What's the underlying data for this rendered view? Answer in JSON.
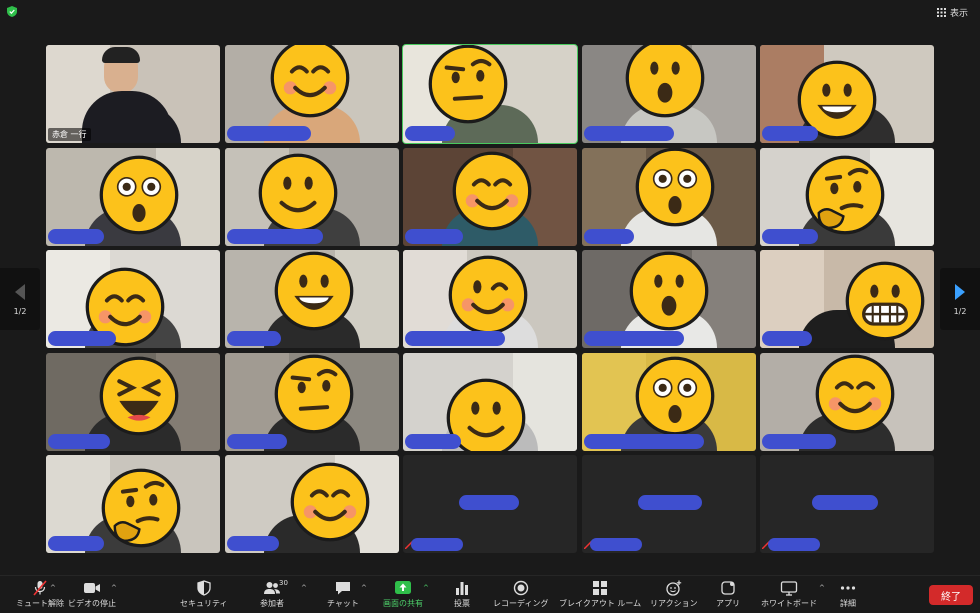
{
  "topbar": {
    "view_label": "表示"
  },
  "tiles": [
    {
      "bg": "#c9c2b8",
      "wall": "#e6e1d8",
      "person": "#1c1c22",
      "name": "赤倉 一行",
      "emoji": "none"
    },
    {
      "bg": "#b3aea6",
      "wall": "#d6d0c6",
      "person": "#d9a77a",
      "emoji": "smile-blush",
      "redact_w": 84
    },
    {
      "bg": "#d6d2c8",
      "wall": "#efece4",
      "person": "#5d6a58",
      "emoji": "raised-eyebrow",
      "redact_w": 50,
      "active": true
    },
    {
      "bg": "#8a8784",
      "wall": "#b8b4ae",
      "person": "#c7c7c2",
      "emoji": "surprised",
      "redact_w": 90
    },
    {
      "bg": "#cfc9bf",
      "wall": "#9b5c3c",
      "person": "#2f2e2e",
      "emoji": "grin",
      "redact_w": 56
    },
    {
      "bg": "#bdb8ae",
      "wall": "#e3ded4",
      "person": "#3a3a40",
      "emoji": "astonished",
      "redact_w": 56
    },
    {
      "bg": "#a9a59e",
      "wall": "#d2cdc3",
      "person": "#3f3f3f",
      "emoji": "slight-smile",
      "redact_w": 96
    },
    {
      "bg": "#5c4436",
      "wall": "#7a5b49",
      "person": "#2e5b67",
      "emoji": "smile-blush",
      "redact_w": 58
    },
    {
      "bg": "#6b5a48",
      "wall": "#8d7a63",
      "person": "#e6e6e3",
      "emoji": "astonished",
      "redact_w": 50
    },
    {
      "bg": "#d5d2cc",
      "wall": "#eeece7",
      "person": "#3a3a3a",
      "emoji": "thinking",
      "redact_w": 56
    },
    {
      "bg": "#dcd9d3",
      "wall": "#f1efea",
      "person": "#444",
      "emoji": "smile-blush",
      "redact_w": 68
    },
    {
      "bg": "#b8b4ac",
      "wall": "#dcd8cf",
      "person": "#2a2a2a",
      "emoji": "grin",
      "redact_w": 54
    },
    {
      "bg": "#cbc7bf",
      "wall": "#e9e6e0",
      "person": "#ddd",
      "emoji": "wink",
      "redact_w": 100
    },
    {
      "bg": "#6e6a66",
      "wall": "#8e8a84",
      "person": "#e8e8e6",
      "emoji": "surprised",
      "redact_w": 100
    },
    {
      "bg": "#c8b9a8",
      "wall": "#e4d8ca",
      "person": "#1e1e1e",
      "emoji": "big-grin",
      "redact_w": 50
    },
    {
      "bg": "#6f6a62",
      "wall": "#8b857b",
      "person": "#2b2b2b",
      "emoji": "laugh",
      "redact_w": 62
    },
    {
      "bg": "#8c8880",
      "wall": "#a9a49a",
      "person": "#2b2b2b",
      "emoji": "raised-eyebrow",
      "redact_w": 60
    },
    {
      "bg": "#d4d2cd",
      "wall": "#ecebe6",
      "person": "#bbb",
      "emoji": "slight-smile",
      "redact_w": 56
    },
    {
      "bg": "#d8b946",
      "wall": "#e7c957",
      "person": "#3a3a3a",
      "emoji": "astonished",
      "redact_w": 120
    },
    {
      "bg": "#b3aea7",
      "wall": "#d0cbc3",
      "person": "#2d2d2d",
      "emoji": "smile-blush",
      "redact_w": 74
    },
    {
      "bg": "#c9c5bd",
      "wall": "#e4e1da",
      "person": "#3b3b3b",
      "emoji": "thinking",
      "redact_w": 56
    },
    {
      "bg": "#cfcbc3",
      "wall": "#ebe8e2",
      "person": "#2a2a2a",
      "emoji": "smile-blush",
      "redact_w": 52
    },
    {
      "empty": true,
      "redact_w": 60,
      "mic_off": true
    },
    {
      "empty": true,
      "redact_w": 64,
      "mic_off": true
    },
    {
      "empty": true,
      "redact_w": 66,
      "mic_off": true
    }
  ],
  "pager": {
    "left_label": "1/2",
    "right_label": "1/2"
  },
  "toolbar": {
    "mute_label": "ミュート解除",
    "video_label": "ビデオの停止",
    "security_label": "セキュリティ",
    "participants_label": "参加者",
    "participants_count": "30",
    "chat_label": "チャット",
    "share_label": "画面の共有",
    "poll_label": "投票",
    "record_label": "レコーディング",
    "breakout_label": "ブレイクアウト ルーム",
    "reactions_label": "リアクション",
    "apps_label": "アプリ",
    "whiteboard_label": "ホワイトボード",
    "more_label": "詳細",
    "end_label": "終了"
  },
  "colors": {
    "accent_green": "#4ed36b",
    "end_red": "#d32a2a",
    "redact_blue": "#3f4fcf",
    "emoji_yellow": "#fcc21b"
  }
}
